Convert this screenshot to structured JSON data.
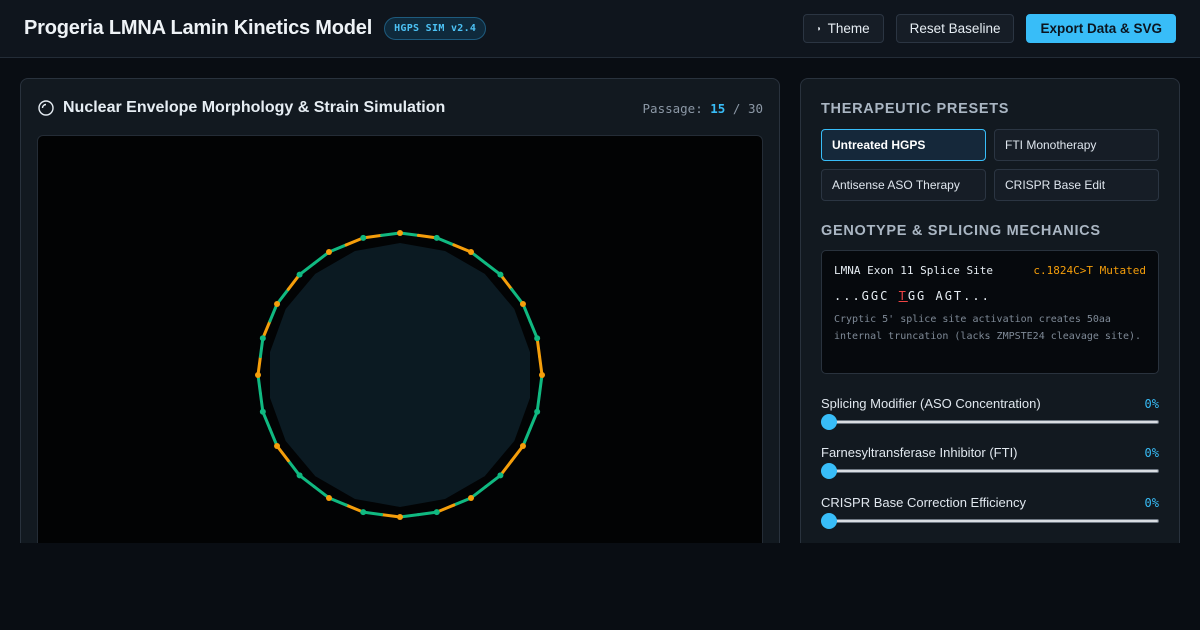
{
  "header": {
    "title": "Progeria LMNA Lamin Kinetics Model",
    "version_badge": "HGPS SIM v2.4",
    "theme_button": "Theme",
    "theme_icon": "half-circle-icon",
    "reset_button": "Reset Baseline",
    "export_button": "Export Data & SVG"
  },
  "simulation": {
    "icon": "spinner-circle-icon",
    "title": "Nuclear Envelope Morphology & Strain Simulation",
    "passage_label": "Passage:",
    "passage_current": "15",
    "passage_separator": "/",
    "passage_total": "30"
  },
  "presets": {
    "title": "THERAPEUTIC PRESETS",
    "items": [
      {
        "label": "Untreated HGPS",
        "active": true
      },
      {
        "label": "FTI Monotherapy",
        "active": false
      },
      {
        "label": "Antisense ASO Therapy",
        "active": false
      },
      {
        "label": "CRISPR Base Edit",
        "active": false
      }
    ]
  },
  "genotype": {
    "title": "GENOTYPE & SPLICING MECHANICS",
    "site_label": "LMNA Exon 11 Splice Site",
    "mutation": "c.1824C>T Mutated",
    "seq_prefix": "...GGC ",
    "seq_mutant": "T",
    "seq_suffix": "GG AGT...",
    "description": "Cryptic 5' splice site activation creates 50aa internal truncation (lacks ZMPSTE24 cleavage site)."
  },
  "sliders": [
    {
      "label": "Splicing Modifier (ASO Concentration)",
      "value": "0%",
      "level": 0
    },
    {
      "label": "Farnesyltransferase Inhibitor (FTI)",
      "value": "0%",
      "level": 0
    },
    {
      "label": "CRISPR Base Correction Efficiency",
      "value": "0%",
      "level": 0
    }
  ],
  "colors": {
    "accent": "#38bdf8",
    "lamin_normal": "#10b981",
    "lamin_progerin": "#f59e0b",
    "nucleus_fill": "#0b1a22"
  }
}
